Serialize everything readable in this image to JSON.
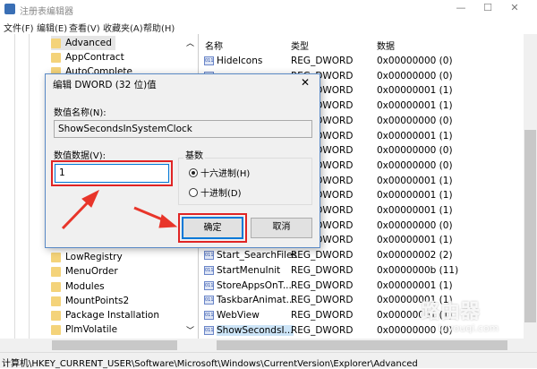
{
  "window": {
    "title": "注册表编辑器",
    "minimize": "—",
    "maximize": "☐",
    "close": "✕"
  },
  "menu": [
    "文件(F)",
    "编辑(E)",
    "查看(V)",
    "收藏夹(A)",
    "帮助(H)"
  ],
  "tree": {
    "items_top": [
      "Advanced",
      "AppContract",
      "AutoComplete"
    ],
    "items_bottom": [
      "LowRegistry",
      "MenuOrder",
      "Modules",
      "MountPoints2",
      "Package Installation",
      "PlmVolatile"
    ]
  },
  "list": {
    "headers": [
      "名称",
      "类型",
      "数据"
    ],
    "rows": [
      {
        "name": "HideIcons",
        "type": "REG_DWORD",
        "data": "0x00000000 (0)"
      },
      {
        "name": "",
        "type": "REG_DWORD",
        "data": "0x00000000 (0)"
      },
      {
        "name": "",
        "type": "REG_DWORD",
        "data": "0x00000001 (1)"
      },
      {
        "name": "",
        "type": "REG_DWORD",
        "data": "0x00000001 (1)"
      },
      {
        "name": "",
        "type": "REG_DWORD",
        "data": "0x00000000 (0)"
      },
      {
        "name": "",
        "type": "REG_DWORD",
        "data": "0x00000001 (1)"
      },
      {
        "name": "",
        "type": "REG_DWORD",
        "data": "0x00000000 (0)"
      },
      {
        "name": "",
        "type": "REG_DWORD",
        "data": "0x00000000 (0)"
      },
      {
        "name": "",
        "type": "REG_DWORD",
        "data": "0x00000001 (1)"
      },
      {
        "name": "",
        "type": "REG_DWORD",
        "data": "0x00000001 (1)"
      },
      {
        "name": "",
        "type": "REG_DWORD",
        "data": "0x00000001 (1)"
      },
      {
        "name": "",
        "type": "REG_DWORD",
        "data": "0x00000000 (0)"
      },
      {
        "name": "",
        "type": "REG_DWORD",
        "data": "0x00000001 (1)"
      },
      {
        "name": "Start_SearchFiles",
        "type": "REG_DWORD",
        "data": "0x00000002 (2)"
      },
      {
        "name": "StartMenuInit",
        "type": "REG_DWORD",
        "data": "0x0000000b (11)"
      },
      {
        "name": "StoreAppsOnT...",
        "type": "REG_DWORD",
        "data": "0x00000001 (1)"
      },
      {
        "name": "TaskbarAnimat...",
        "type": "REG_DWORD",
        "data": "0x00000001 (1)"
      },
      {
        "name": "WebView",
        "type": "REG_DWORD",
        "data": "0x00000001 (1)"
      },
      {
        "name": "ShowSecondsI...",
        "type": "REG_DWORD",
        "data": "0x00000000 (0)"
      }
    ]
  },
  "status": "计算机\\HKEY_CURRENT_USER\\Software\\Microsoft\\Windows\\CurrentVersion\\Explorer\\Advanced",
  "dialog": {
    "title": "编辑 DWORD (32 位)值",
    "close": "✕",
    "name_label": "数值名称(N):",
    "name_value": "ShowSecondsInSystemClock",
    "data_label": "数值数据(V):",
    "data_value": "1",
    "base_label": "基数",
    "hex": "十六进制(H)",
    "dec": "十进制(D)",
    "ok": "确定",
    "cancel": "取消"
  },
  "watermark": {
    "text": "路由器",
    "url": "luyouqi.com"
  },
  "colors": {
    "highlight": "#e02424",
    "accent": "#0078d7"
  }
}
